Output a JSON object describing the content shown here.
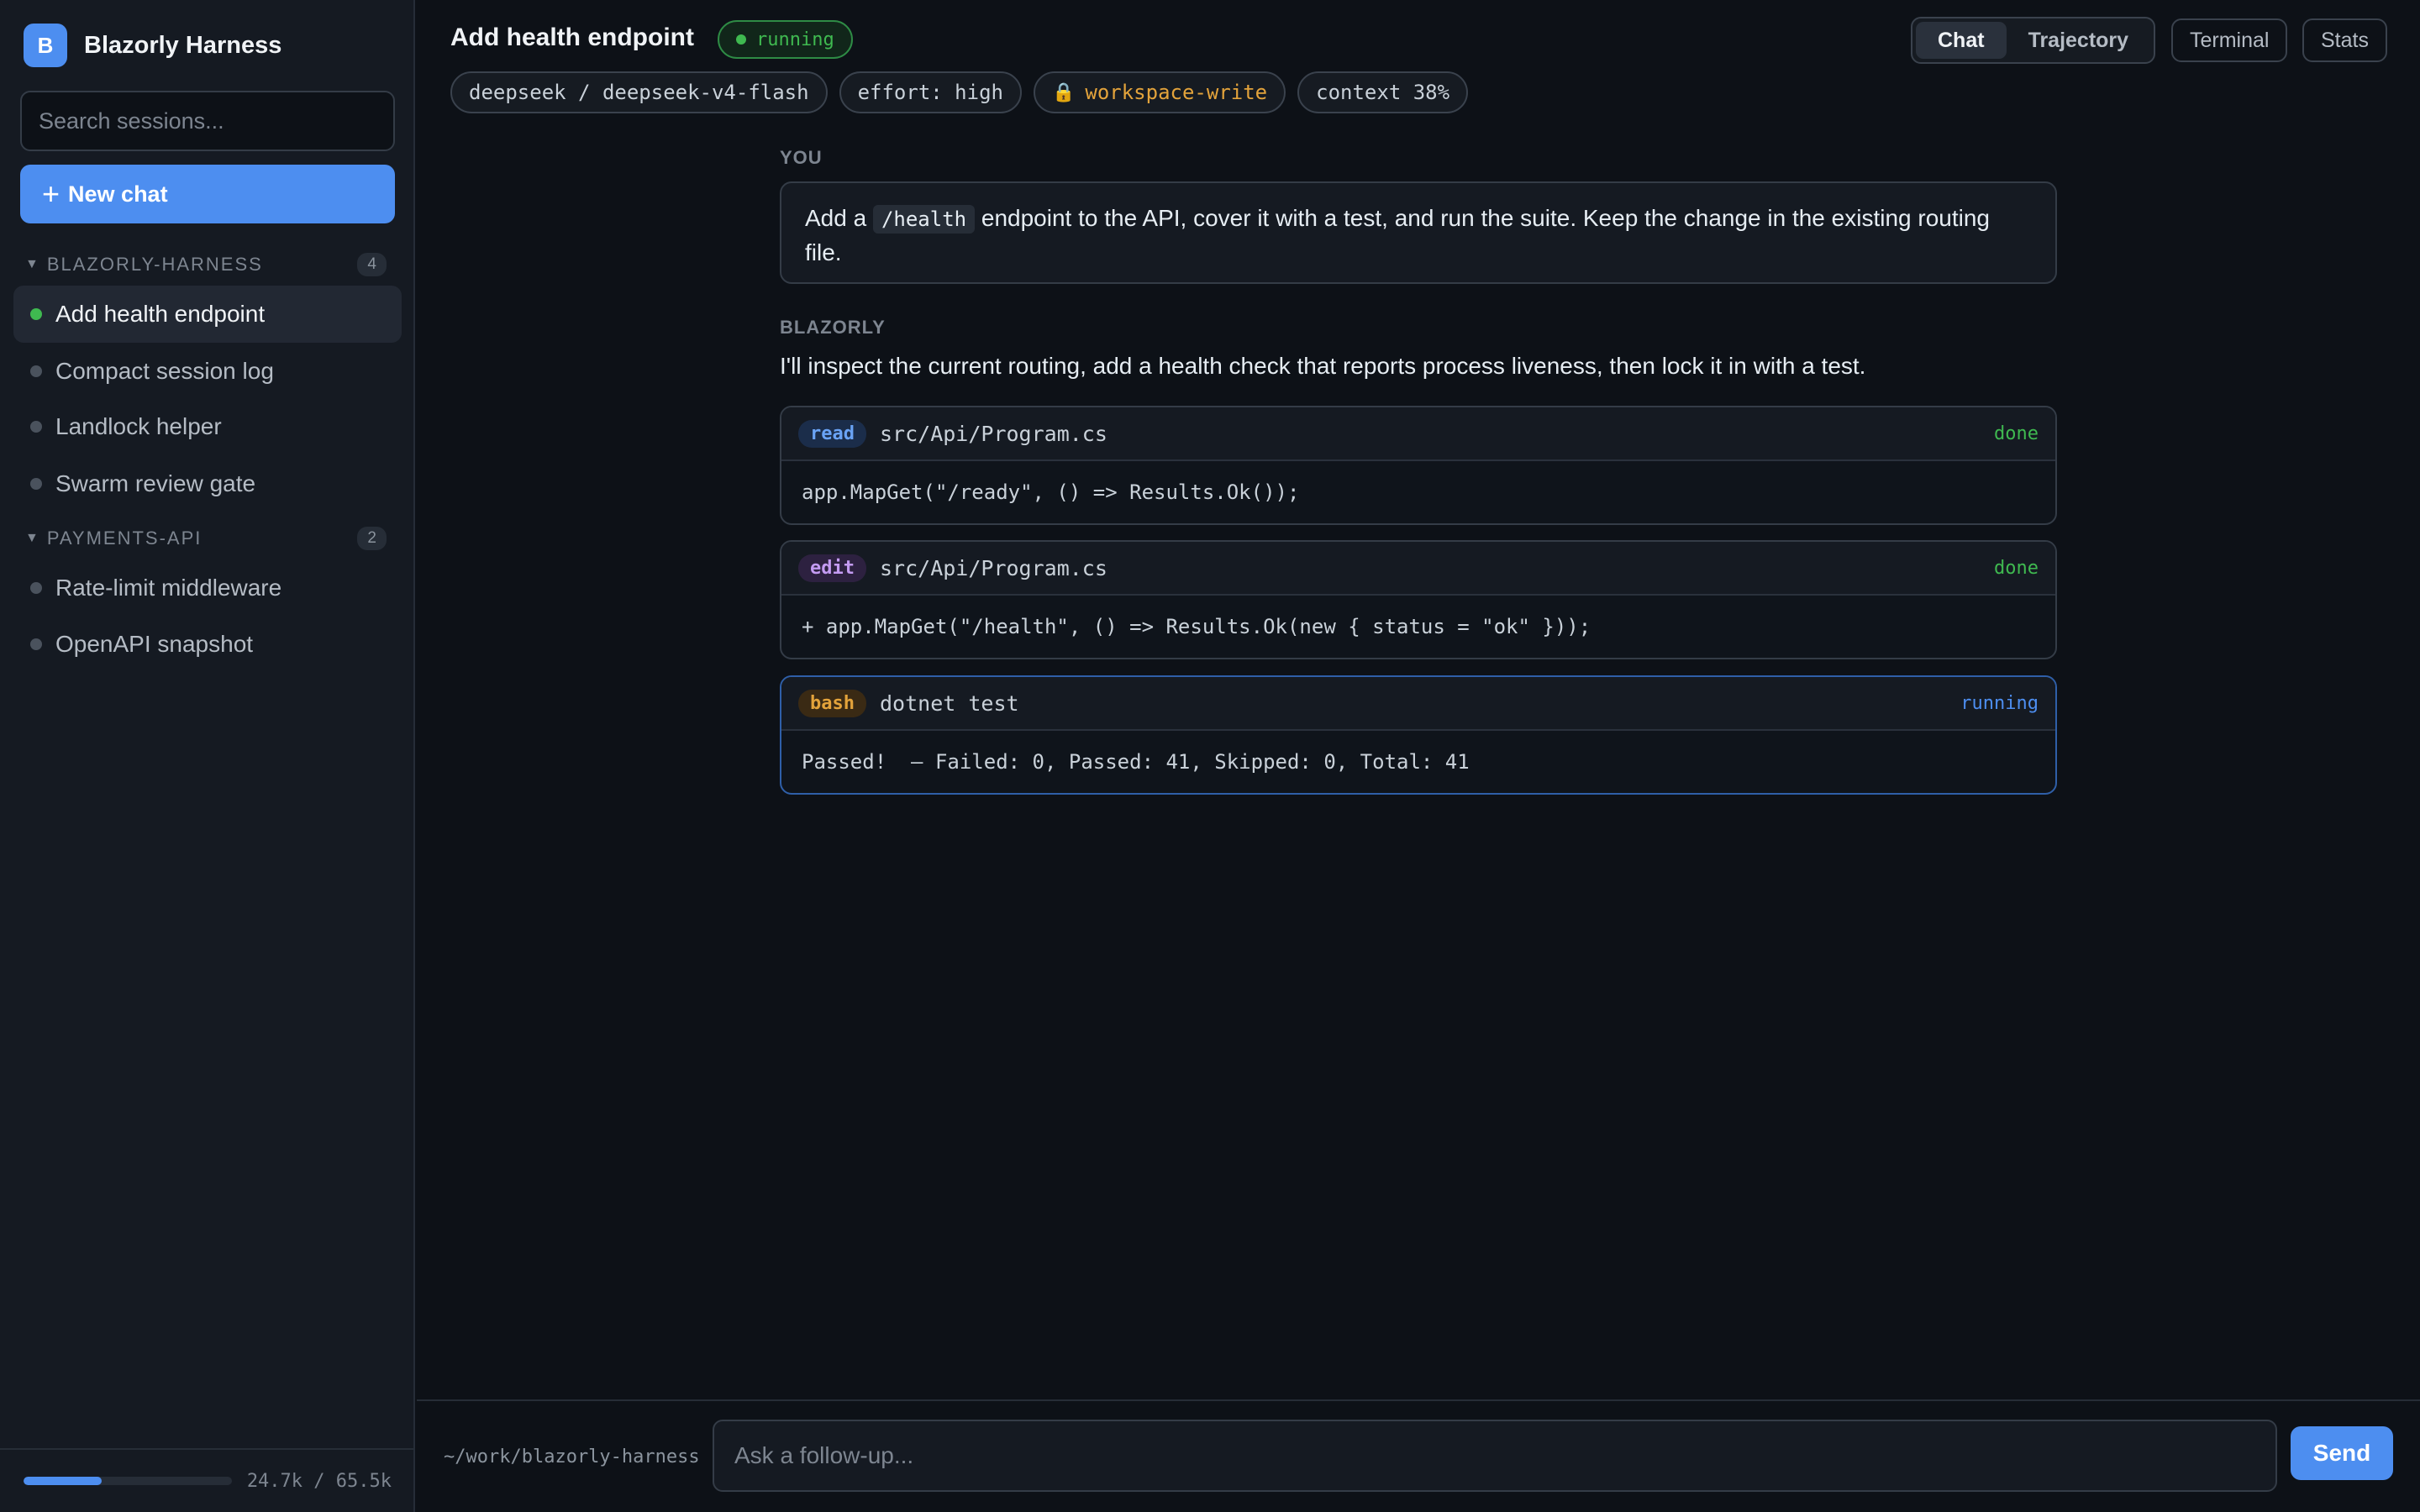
{
  "app": {
    "logo_letter": "B",
    "name": "Blazorly Harness"
  },
  "sidebar": {
    "search_placeholder": "Search sessions...",
    "new_chat_icon": "+",
    "new_chat_label": "New chat",
    "groups": [
      {
        "caret": "▼",
        "name": "BLAZORLY-HARNESS",
        "count": "4",
        "sessions": [
          {
            "label": "Add health endpoint",
            "active": true
          },
          {
            "label": "Compact session log",
            "active": false
          },
          {
            "label": "Landlock helper",
            "active": false
          },
          {
            "label": "Swarm review gate",
            "active": false
          }
        ]
      },
      {
        "caret": "▼",
        "name": "PAYMENTS-API",
        "count": "2",
        "sessions": [
          {
            "label": "Rate-limit middleware",
            "active": false
          },
          {
            "label": "OpenAPI snapshot",
            "active": false
          }
        ]
      }
    ],
    "usage": {
      "text": "24.7k / 65.5k",
      "fraction": 0.377
    }
  },
  "header": {
    "title": "Add health endpoint",
    "status": "running",
    "chips": {
      "model": "deepseek / deepseek-v4-flash",
      "effort": "effort: high",
      "sandbox_icon": "🔒",
      "sandbox": "workspace-write",
      "context": "context 38%"
    },
    "tabs": {
      "chat": "Chat",
      "trajectory": "Trajectory"
    },
    "buttons": {
      "terminal": "Terminal",
      "stats": "Stats"
    }
  },
  "conversation": {
    "user_label": "YOU",
    "user_message": {
      "before": "Add a ",
      "code": "/health",
      "after": " endpoint to the API, cover it with a test, and run the suite. Keep the change in the existing routing file."
    },
    "assistant_label": "BLAZORLY",
    "assistant_text": "I'll inspect the current routing, add a health check that reports process liveness, then lock it in with a test.",
    "tools": [
      {
        "kind": "read",
        "target": "src/Api/Program.cs",
        "status": "done",
        "output": "app.MapGet(\"/ready\", () => Results.Ok());"
      },
      {
        "kind": "edit",
        "target": "src/Api/Program.cs",
        "status": "done",
        "output": "+ app.MapGet(\"/health\", () => Results.Ok(new { status = \"ok\" }));"
      },
      {
        "kind": "bash",
        "target": "dotnet test",
        "status": "running",
        "output": "Passed!  – Failed: 0, Passed: 41, Skipped: 0, Total: 41"
      }
    ]
  },
  "composer": {
    "cwd": "~/work/blazorly-harness",
    "placeholder": "Ask a follow-up...",
    "send_label": "Send"
  },
  "colors": {
    "accent": "#4d8ef0",
    "running_green": "#3fb950",
    "warning_amber": "#e3a33b",
    "background": "#0d1117",
    "sidebar": "#151a22"
  }
}
